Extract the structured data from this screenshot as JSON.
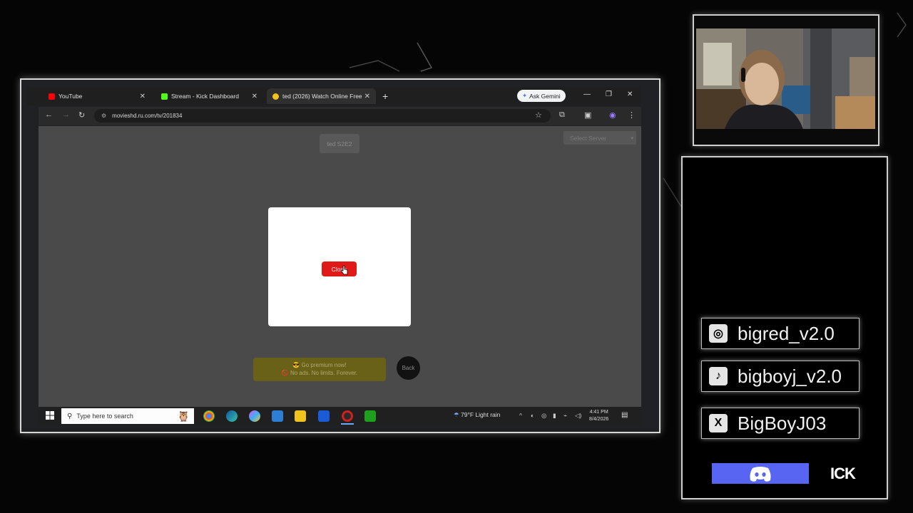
{
  "browser": {
    "tabs": [
      {
        "label": "YouTube",
        "color": "#ff0000"
      },
      {
        "label": "Stream - Kick Dashboard",
        "color": "#53fc18"
      },
      {
        "label": "ted (2026) Watch Online Free",
        "color": "#f0c419",
        "active": true
      }
    ],
    "gemini_label": "Ask Gemini",
    "url": "movieshd.ru.com/tv/201834"
  },
  "page": {
    "episode_label": "ted S2E2",
    "server_select": "Select Server",
    "close_label": "Close",
    "premium_line1": "😎 Go premium now!",
    "premium_line2": "🚫 No ads. No limits. Forever.",
    "back_label": "Back"
  },
  "taskbar": {
    "search_placeholder": "Type here to search",
    "weather": "79°F  Light rain",
    "time": "4:41 PM",
    "date": "8/4/2026"
  },
  "overlay": {
    "socials": [
      {
        "icon": "instagram-icon",
        "glyph": "◎",
        "label": "bigred_v2.0"
      },
      {
        "icon": "tiktok-icon",
        "glyph": "♪",
        "label": "bigboyj_v2.0"
      },
      {
        "icon": "x-icon",
        "glyph": "X",
        "label": "BigBoyJ03"
      }
    ],
    "kick_text": "ICK"
  }
}
